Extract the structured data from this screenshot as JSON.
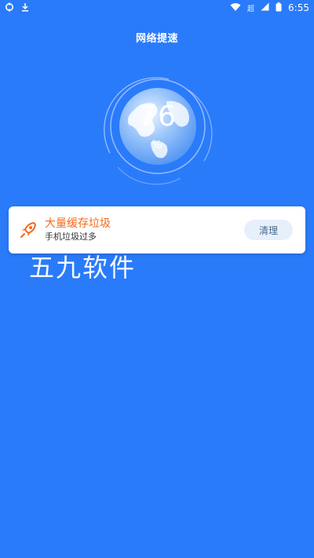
{
  "status_bar": {
    "time": "6:55",
    "signal_label": "超",
    "icons": [
      "app-notification-icon",
      "download-icon",
      "wifi-icon",
      "signal-icon",
      "battery-icon"
    ]
  },
  "header": {
    "title": "网络提速"
  },
  "gauge": {
    "value": "76",
    "unit": "%"
  },
  "card": {
    "icon": "rocket-icon",
    "title": "大量缓存垃圾",
    "subtitle": "手机垃圾过多",
    "button_label": "清理"
  },
  "watermark": {
    "text": "五九软件"
  },
  "colors": {
    "background": "#2a7bfa",
    "card_title": "#f26b1d",
    "button_bg": "#e7effa",
    "button_text": "#4a6a8e"
  }
}
